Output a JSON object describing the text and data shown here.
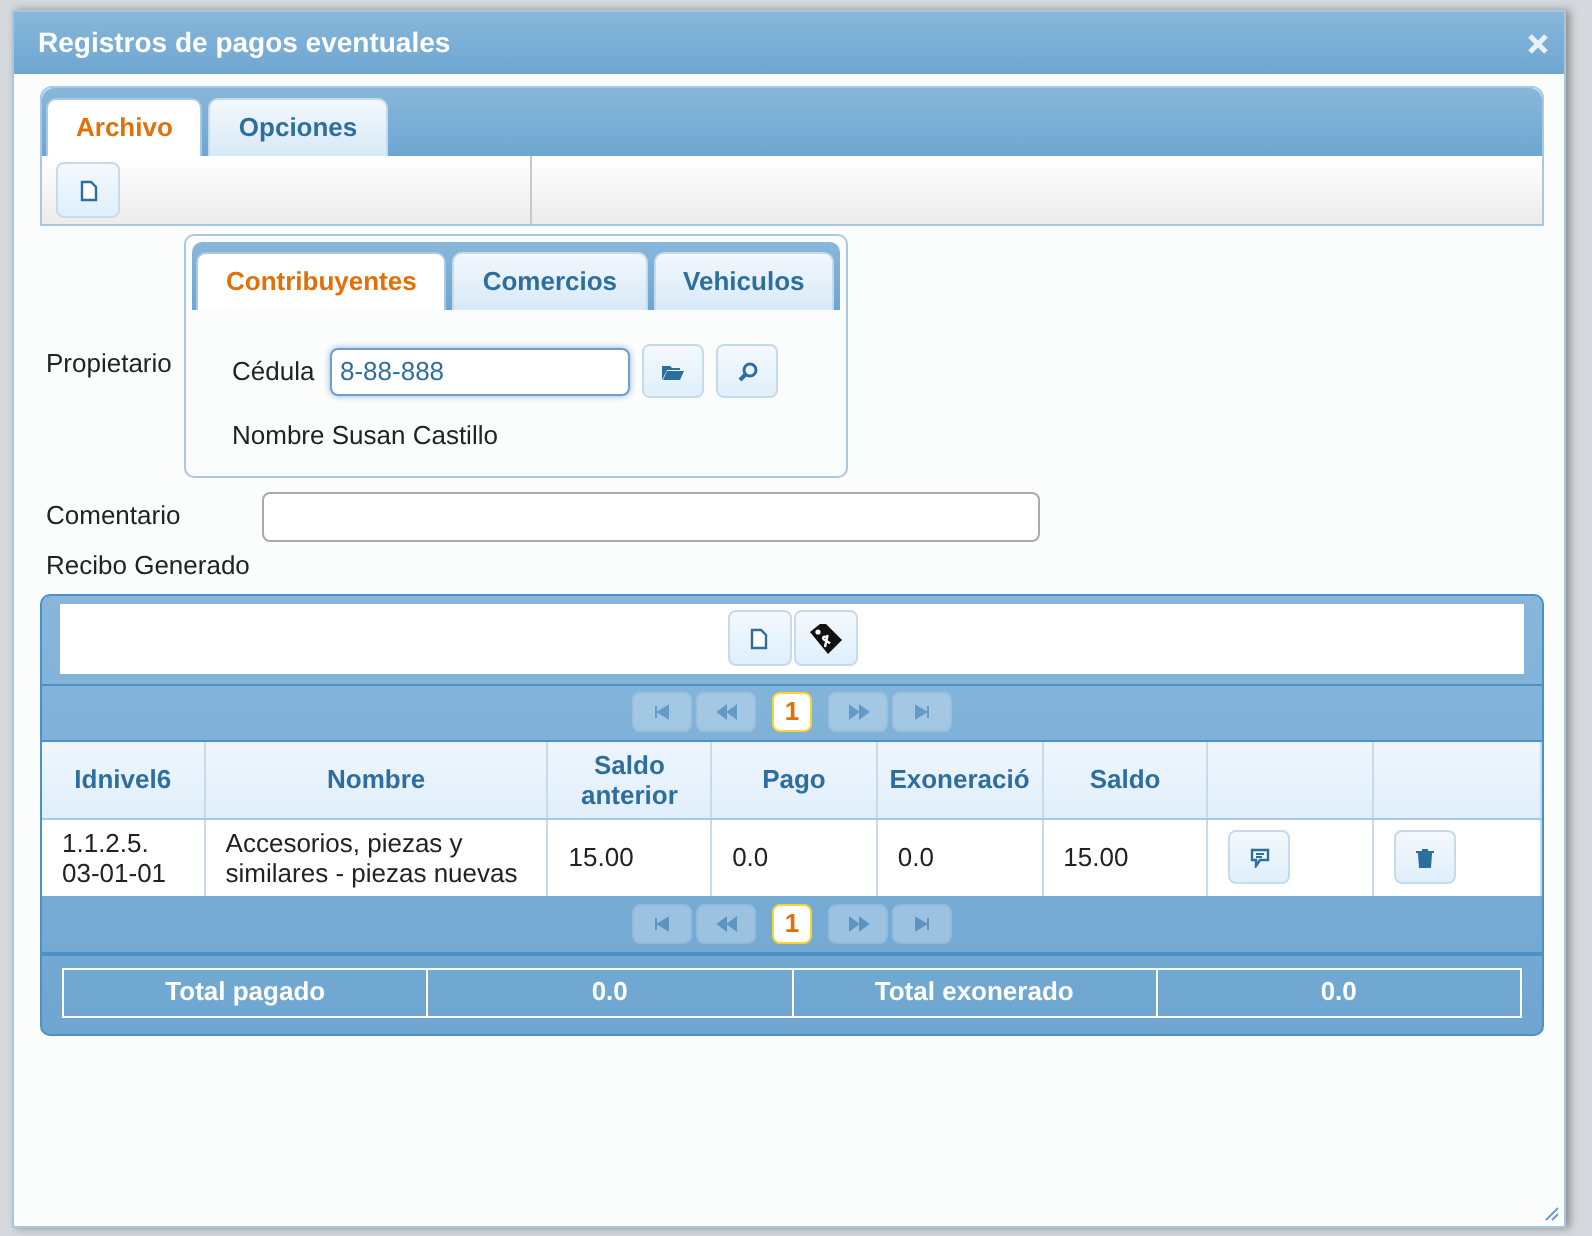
{
  "window": {
    "title": "Registros de pagos eventuales"
  },
  "toolbar": {
    "tabs": [
      {
        "label": "Archivo",
        "selected": true
      },
      {
        "label": "Opciones",
        "selected": false
      }
    ]
  },
  "owner": {
    "label": "Propietario",
    "tabs": [
      {
        "label": "Contribuyentes",
        "selected": true
      },
      {
        "label": "Comercios",
        "selected": false
      },
      {
        "label": "Vehiculos",
        "selected": false
      }
    ],
    "id_label": "Cédula",
    "id_value": "8-88-888",
    "name_text": "Nombre Susan Castillo"
  },
  "comment": {
    "label": "Comentario"
  },
  "receipt": {
    "label": "Recibo Generado",
    "pagers": [
      {
        "page": "1",
        "nav_disabled": true
      },
      {
        "page": "1",
        "nav_disabled": true
      }
    ],
    "columns": [
      "Idnivel6",
      "Nombre",
      "Saldo anterior",
      "Pago",
      "Exoneració",
      "Saldo"
    ],
    "rows": [
      {
        "cells": [
          "1.1.2.5. 03-01-01",
          "Accesorios, piezas y similares - piezas nuevas",
          "15.00",
          "0.0",
          "0.0",
          "15.00"
        ]
      }
    ],
    "totals": [
      "Total pagado",
      "0.0",
      "Total exonerado",
      "0.0"
    ]
  }
}
